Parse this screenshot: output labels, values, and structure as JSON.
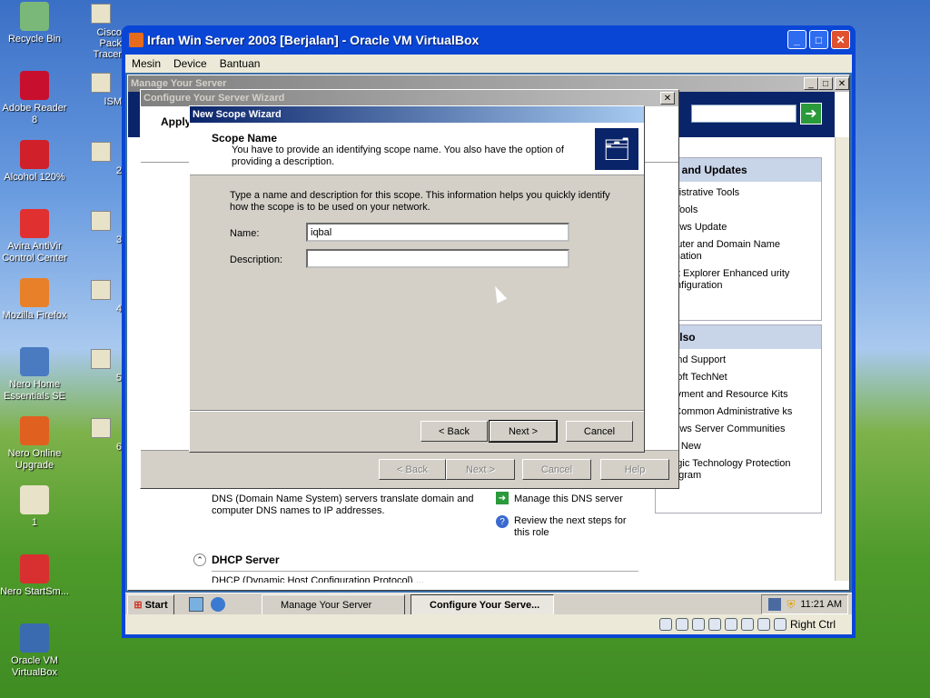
{
  "desktop": {
    "icons": [
      {
        "name": "recycle-bin-icon",
        "label": "Recycle Bin",
        "color": "#7ab87a"
      },
      {
        "name": "adobe-reader-icon",
        "label": "Adobe Reader 8",
        "color": "#c8102e"
      },
      {
        "name": "alcohol-icon",
        "label": "Alcohol 120%",
        "color": "#d0202a"
      },
      {
        "name": "avira-icon",
        "label": "Avira AntiVir Control Center",
        "color": "#e03030"
      },
      {
        "name": "firefox-icon",
        "label": "Mozilla Firefox",
        "color": "#e8802a"
      },
      {
        "name": "nero-home-icon",
        "label": "Nero Home Essentials SE",
        "color": "#4a7ac0"
      },
      {
        "name": "nero-online-icon",
        "label": "Nero Online Upgrade",
        "color": "#e06020"
      },
      {
        "name": "file-icon",
        "label": "1",
        "color": "#e8e2c8"
      },
      {
        "name": "nero-startsmart-icon",
        "label": "Nero StartSm...",
        "color": "#d83030"
      },
      {
        "name": "virtualbox-icon",
        "label": "Oracle VM VirtualBox",
        "color": "#3a6ab0"
      }
    ],
    "col2": [
      {
        "label": "Cisco Pack Tracer"
      },
      {
        "label": "ISM"
      },
      {
        "label": "2"
      },
      {
        "label": "3"
      },
      {
        "label": "4"
      },
      {
        "label": "5"
      },
      {
        "label": "6"
      }
    ]
  },
  "vbox": {
    "title": "Irfan Win Server 2003 [Berjalan] - Oracle VM VirtualBox",
    "menu": [
      "Mesin",
      "Device",
      "Bantuan"
    ],
    "host_key": "Right Ctrl"
  },
  "manage": {
    "title": "Manage Your Server",
    "sections": {
      "tools_header": "ols and Updates",
      "tools": [
        "ministrative Tools",
        "re Tools",
        "ndows Update",
        "mputer and Domain Name ormation",
        "rnet Explorer Enhanced urity Configuration"
      ],
      "see_header": "e Also",
      "see": [
        "o and Support",
        "rosoft TechNet",
        "oloyment and Resource Kits",
        "of Common Administrative ks",
        "ndows Server Communities",
        "at's New",
        "ategic Technology Protection Program"
      ]
    },
    "dns_desc": "DNS (Domain Name System) servers translate domain and computer DNS names to IP addresses.",
    "dns_manage": "Manage this DNS server",
    "dns_review": "Review the next steps for this role",
    "dhcp_title": "DHCP Server",
    "dhcp_partial": "DHCP (Dynamic Host Configuration Protocol) ..."
  },
  "cysw": {
    "title": "Configure Your Server Wizard",
    "apply": "Apply",
    "back": "< Back",
    "next": "Next >",
    "cancel": "Cancel",
    "help": "Help"
  },
  "nsw": {
    "title": "New Scope Wizard",
    "header": "Scope Name",
    "subheader": "You have to provide an identifying scope name. You also have the option of providing a description.",
    "instructions": "Type a name and description for this scope. This information helps you quickly identify how the scope is to be used on your network.",
    "name_label": "Name:",
    "name_value": "iqbal",
    "desc_label": "Description:",
    "desc_value": "",
    "back": "< Back",
    "next": "Next >",
    "cancel": "Cancel"
  },
  "taskbar": {
    "start": "Start",
    "tasks": [
      "Manage Your Server",
      "Configure Your Serve..."
    ],
    "clock": "11:21 AM"
  }
}
